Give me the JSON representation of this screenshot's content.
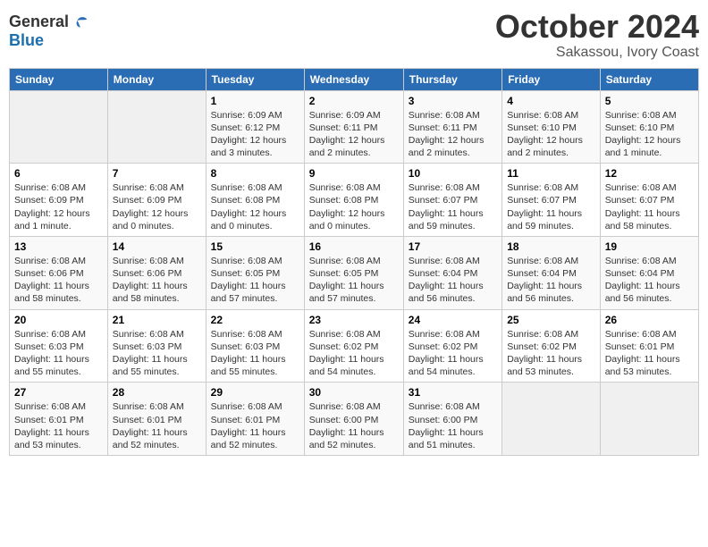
{
  "header": {
    "logo_line1": "General",
    "logo_line2": "Blue",
    "title": "October 2024",
    "subtitle": "Sakassou, Ivory Coast"
  },
  "weekdays": [
    "Sunday",
    "Monday",
    "Tuesday",
    "Wednesday",
    "Thursday",
    "Friday",
    "Saturday"
  ],
  "weeks": [
    [
      {
        "day": "",
        "info": ""
      },
      {
        "day": "",
        "info": ""
      },
      {
        "day": "1",
        "info": "Sunrise: 6:09 AM\nSunset: 6:12 PM\nDaylight: 12 hours and 3 minutes."
      },
      {
        "day": "2",
        "info": "Sunrise: 6:09 AM\nSunset: 6:11 PM\nDaylight: 12 hours and 2 minutes."
      },
      {
        "day": "3",
        "info": "Sunrise: 6:08 AM\nSunset: 6:11 PM\nDaylight: 12 hours and 2 minutes."
      },
      {
        "day": "4",
        "info": "Sunrise: 6:08 AM\nSunset: 6:10 PM\nDaylight: 12 hours and 2 minutes."
      },
      {
        "day": "5",
        "info": "Sunrise: 6:08 AM\nSunset: 6:10 PM\nDaylight: 12 hours and 1 minute."
      }
    ],
    [
      {
        "day": "6",
        "info": "Sunrise: 6:08 AM\nSunset: 6:09 PM\nDaylight: 12 hours and 1 minute."
      },
      {
        "day": "7",
        "info": "Sunrise: 6:08 AM\nSunset: 6:09 PM\nDaylight: 12 hours and 0 minutes."
      },
      {
        "day": "8",
        "info": "Sunrise: 6:08 AM\nSunset: 6:08 PM\nDaylight: 12 hours and 0 minutes."
      },
      {
        "day": "9",
        "info": "Sunrise: 6:08 AM\nSunset: 6:08 PM\nDaylight: 12 hours and 0 minutes."
      },
      {
        "day": "10",
        "info": "Sunrise: 6:08 AM\nSunset: 6:07 PM\nDaylight: 11 hours and 59 minutes."
      },
      {
        "day": "11",
        "info": "Sunrise: 6:08 AM\nSunset: 6:07 PM\nDaylight: 11 hours and 59 minutes."
      },
      {
        "day": "12",
        "info": "Sunrise: 6:08 AM\nSunset: 6:07 PM\nDaylight: 11 hours and 58 minutes."
      }
    ],
    [
      {
        "day": "13",
        "info": "Sunrise: 6:08 AM\nSunset: 6:06 PM\nDaylight: 11 hours and 58 minutes."
      },
      {
        "day": "14",
        "info": "Sunrise: 6:08 AM\nSunset: 6:06 PM\nDaylight: 11 hours and 58 minutes."
      },
      {
        "day": "15",
        "info": "Sunrise: 6:08 AM\nSunset: 6:05 PM\nDaylight: 11 hours and 57 minutes."
      },
      {
        "day": "16",
        "info": "Sunrise: 6:08 AM\nSunset: 6:05 PM\nDaylight: 11 hours and 57 minutes."
      },
      {
        "day": "17",
        "info": "Sunrise: 6:08 AM\nSunset: 6:04 PM\nDaylight: 11 hours and 56 minutes."
      },
      {
        "day": "18",
        "info": "Sunrise: 6:08 AM\nSunset: 6:04 PM\nDaylight: 11 hours and 56 minutes."
      },
      {
        "day": "19",
        "info": "Sunrise: 6:08 AM\nSunset: 6:04 PM\nDaylight: 11 hours and 56 minutes."
      }
    ],
    [
      {
        "day": "20",
        "info": "Sunrise: 6:08 AM\nSunset: 6:03 PM\nDaylight: 11 hours and 55 minutes."
      },
      {
        "day": "21",
        "info": "Sunrise: 6:08 AM\nSunset: 6:03 PM\nDaylight: 11 hours and 55 minutes."
      },
      {
        "day": "22",
        "info": "Sunrise: 6:08 AM\nSunset: 6:03 PM\nDaylight: 11 hours and 55 minutes."
      },
      {
        "day": "23",
        "info": "Sunrise: 6:08 AM\nSunset: 6:02 PM\nDaylight: 11 hours and 54 minutes."
      },
      {
        "day": "24",
        "info": "Sunrise: 6:08 AM\nSunset: 6:02 PM\nDaylight: 11 hours and 54 minutes."
      },
      {
        "day": "25",
        "info": "Sunrise: 6:08 AM\nSunset: 6:02 PM\nDaylight: 11 hours and 53 minutes."
      },
      {
        "day": "26",
        "info": "Sunrise: 6:08 AM\nSunset: 6:01 PM\nDaylight: 11 hours and 53 minutes."
      }
    ],
    [
      {
        "day": "27",
        "info": "Sunrise: 6:08 AM\nSunset: 6:01 PM\nDaylight: 11 hours and 53 minutes."
      },
      {
        "day": "28",
        "info": "Sunrise: 6:08 AM\nSunset: 6:01 PM\nDaylight: 11 hours and 52 minutes."
      },
      {
        "day": "29",
        "info": "Sunrise: 6:08 AM\nSunset: 6:01 PM\nDaylight: 11 hours and 52 minutes."
      },
      {
        "day": "30",
        "info": "Sunrise: 6:08 AM\nSunset: 6:00 PM\nDaylight: 11 hours and 52 minutes."
      },
      {
        "day": "31",
        "info": "Sunrise: 6:08 AM\nSunset: 6:00 PM\nDaylight: 11 hours and 51 minutes."
      },
      {
        "day": "",
        "info": ""
      },
      {
        "day": "",
        "info": ""
      }
    ]
  ]
}
